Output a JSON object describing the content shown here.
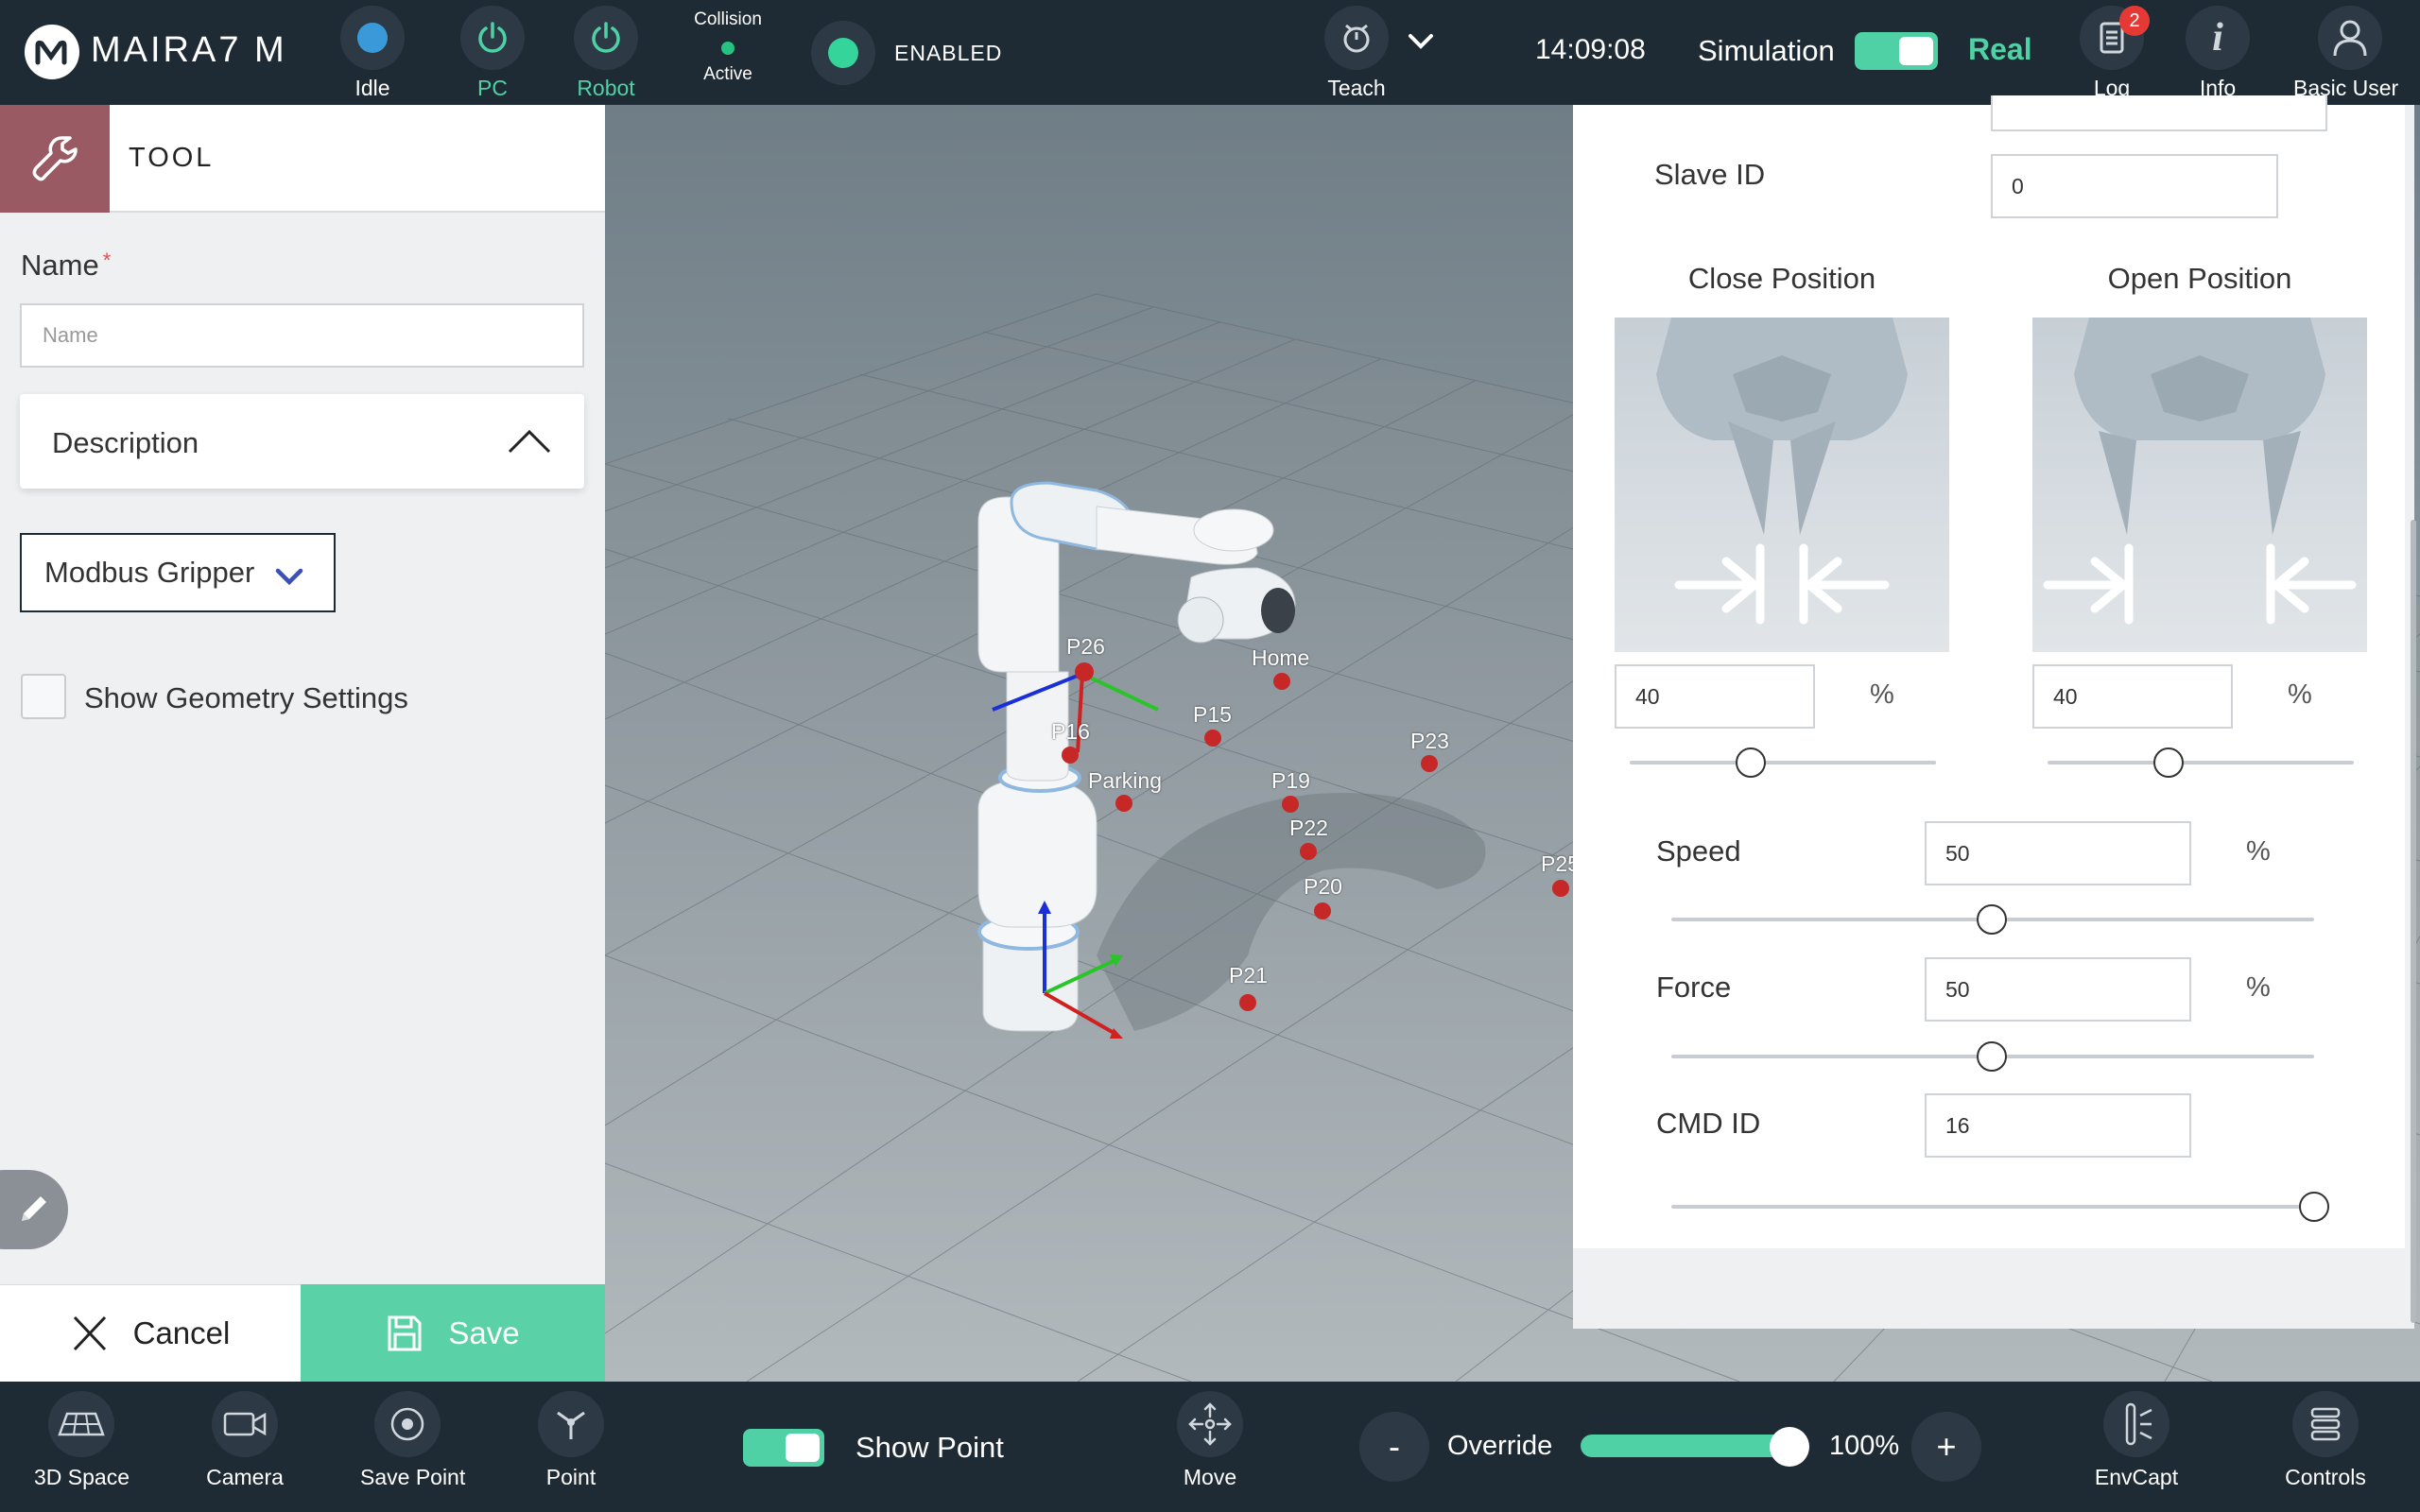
{
  "colors": {
    "topbar_bg": "#1e2a34",
    "accent_teal": "#4fd1a5",
    "tool_header_icon_bg": "#9a5a64",
    "badge_red": "#e53935",
    "enabled_green": "#35d49b",
    "point_red": "#c62828"
  },
  "topbar": {
    "logo": {
      "text": "MAIRA7 M",
      "icon": "neura-logo-icon"
    },
    "status": [
      {
        "label": "Idle",
        "icon": "idle-status-icon"
      },
      {
        "label": "PC",
        "icon": "power-icon"
      },
      {
        "label": "Robot",
        "icon": "power-icon"
      }
    ],
    "collision": {
      "title": "Collision",
      "state": "Active"
    },
    "enabled": {
      "label": "ENABLED"
    },
    "teach": {
      "label": "Teach",
      "icon": "teach-icon"
    },
    "time": "14:09:08",
    "simulation_label": "Simulation",
    "simulation_toggle_on": true,
    "real_label": "Real",
    "log": {
      "label": "Log",
      "badge": "2",
      "icon": "log-icon"
    },
    "info": {
      "label": "Info",
      "icon": "info-icon"
    },
    "user": {
      "label": "Basic User",
      "icon": "user-icon"
    }
  },
  "left_panel": {
    "header_title": "TOOL",
    "header_icon": "wrench-icon",
    "name_label": "Name",
    "name_required_mark": "*",
    "name_placeholder": "Name",
    "name_value": "",
    "description_label": "Description",
    "tool_type_selected": "Modbus Gripper",
    "show_geometry_label": "Show Geometry Settings",
    "show_geometry_checked": false,
    "cancel_label": "Cancel",
    "save_label": "Save"
  },
  "viewport": {
    "points": [
      {
        "label": "P26"
      },
      {
        "label": "Home"
      },
      {
        "label": "P16"
      },
      {
        "label": "P15"
      },
      {
        "label": "P23"
      },
      {
        "label": "Parking"
      },
      {
        "label": "P19"
      },
      {
        "label": "P22"
      },
      {
        "label": "P20"
      },
      {
        "label": "P25"
      },
      {
        "label": "P21"
      }
    ]
  },
  "right_panel": {
    "slave_id_label": "Slave ID",
    "slave_id_value": "0",
    "close_position": {
      "title": "Close Position",
      "value": "40",
      "unit": "%",
      "slider_fraction": 0.4
    },
    "open_position": {
      "title": "Open Position",
      "value": "40",
      "unit": "%",
      "slider_fraction": 0.4
    },
    "speed": {
      "label": "Speed",
      "value": "50",
      "unit": "%",
      "slider_fraction": 0.5
    },
    "force": {
      "label": "Force",
      "value": "50",
      "unit": "%",
      "slider_fraction": 0.5
    },
    "cmd_id": {
      "label": "CMD ID",
      "value": "16",
      "slider_fraction": 1.0
    }
  },
  "bottombar": {
    "buttons_left": [
      {
        "label": "3D Space",
        "icon": "grid-3d-icon"
      },
      {
        "label": "Camera",
        "icon": "camera-icon"
      },
      {
        "label": "Save Point",
        "icon": "target-icon"
      },
      {
        "label": "Point",
        "icon": "point-icon"
      }
    ],
    "show_point_label": "Show Point",
    "show_point_on": true,
    "move_label": "Move",
    "override_label": "Override",
    "override_minus": "-",
    "override_plus": "+",
    "override_value": "100%",
    "override_fraction": 1.0,
    "envcapt_label": "EnvCapt",
    "controls_label": "Controls"
  }
}
